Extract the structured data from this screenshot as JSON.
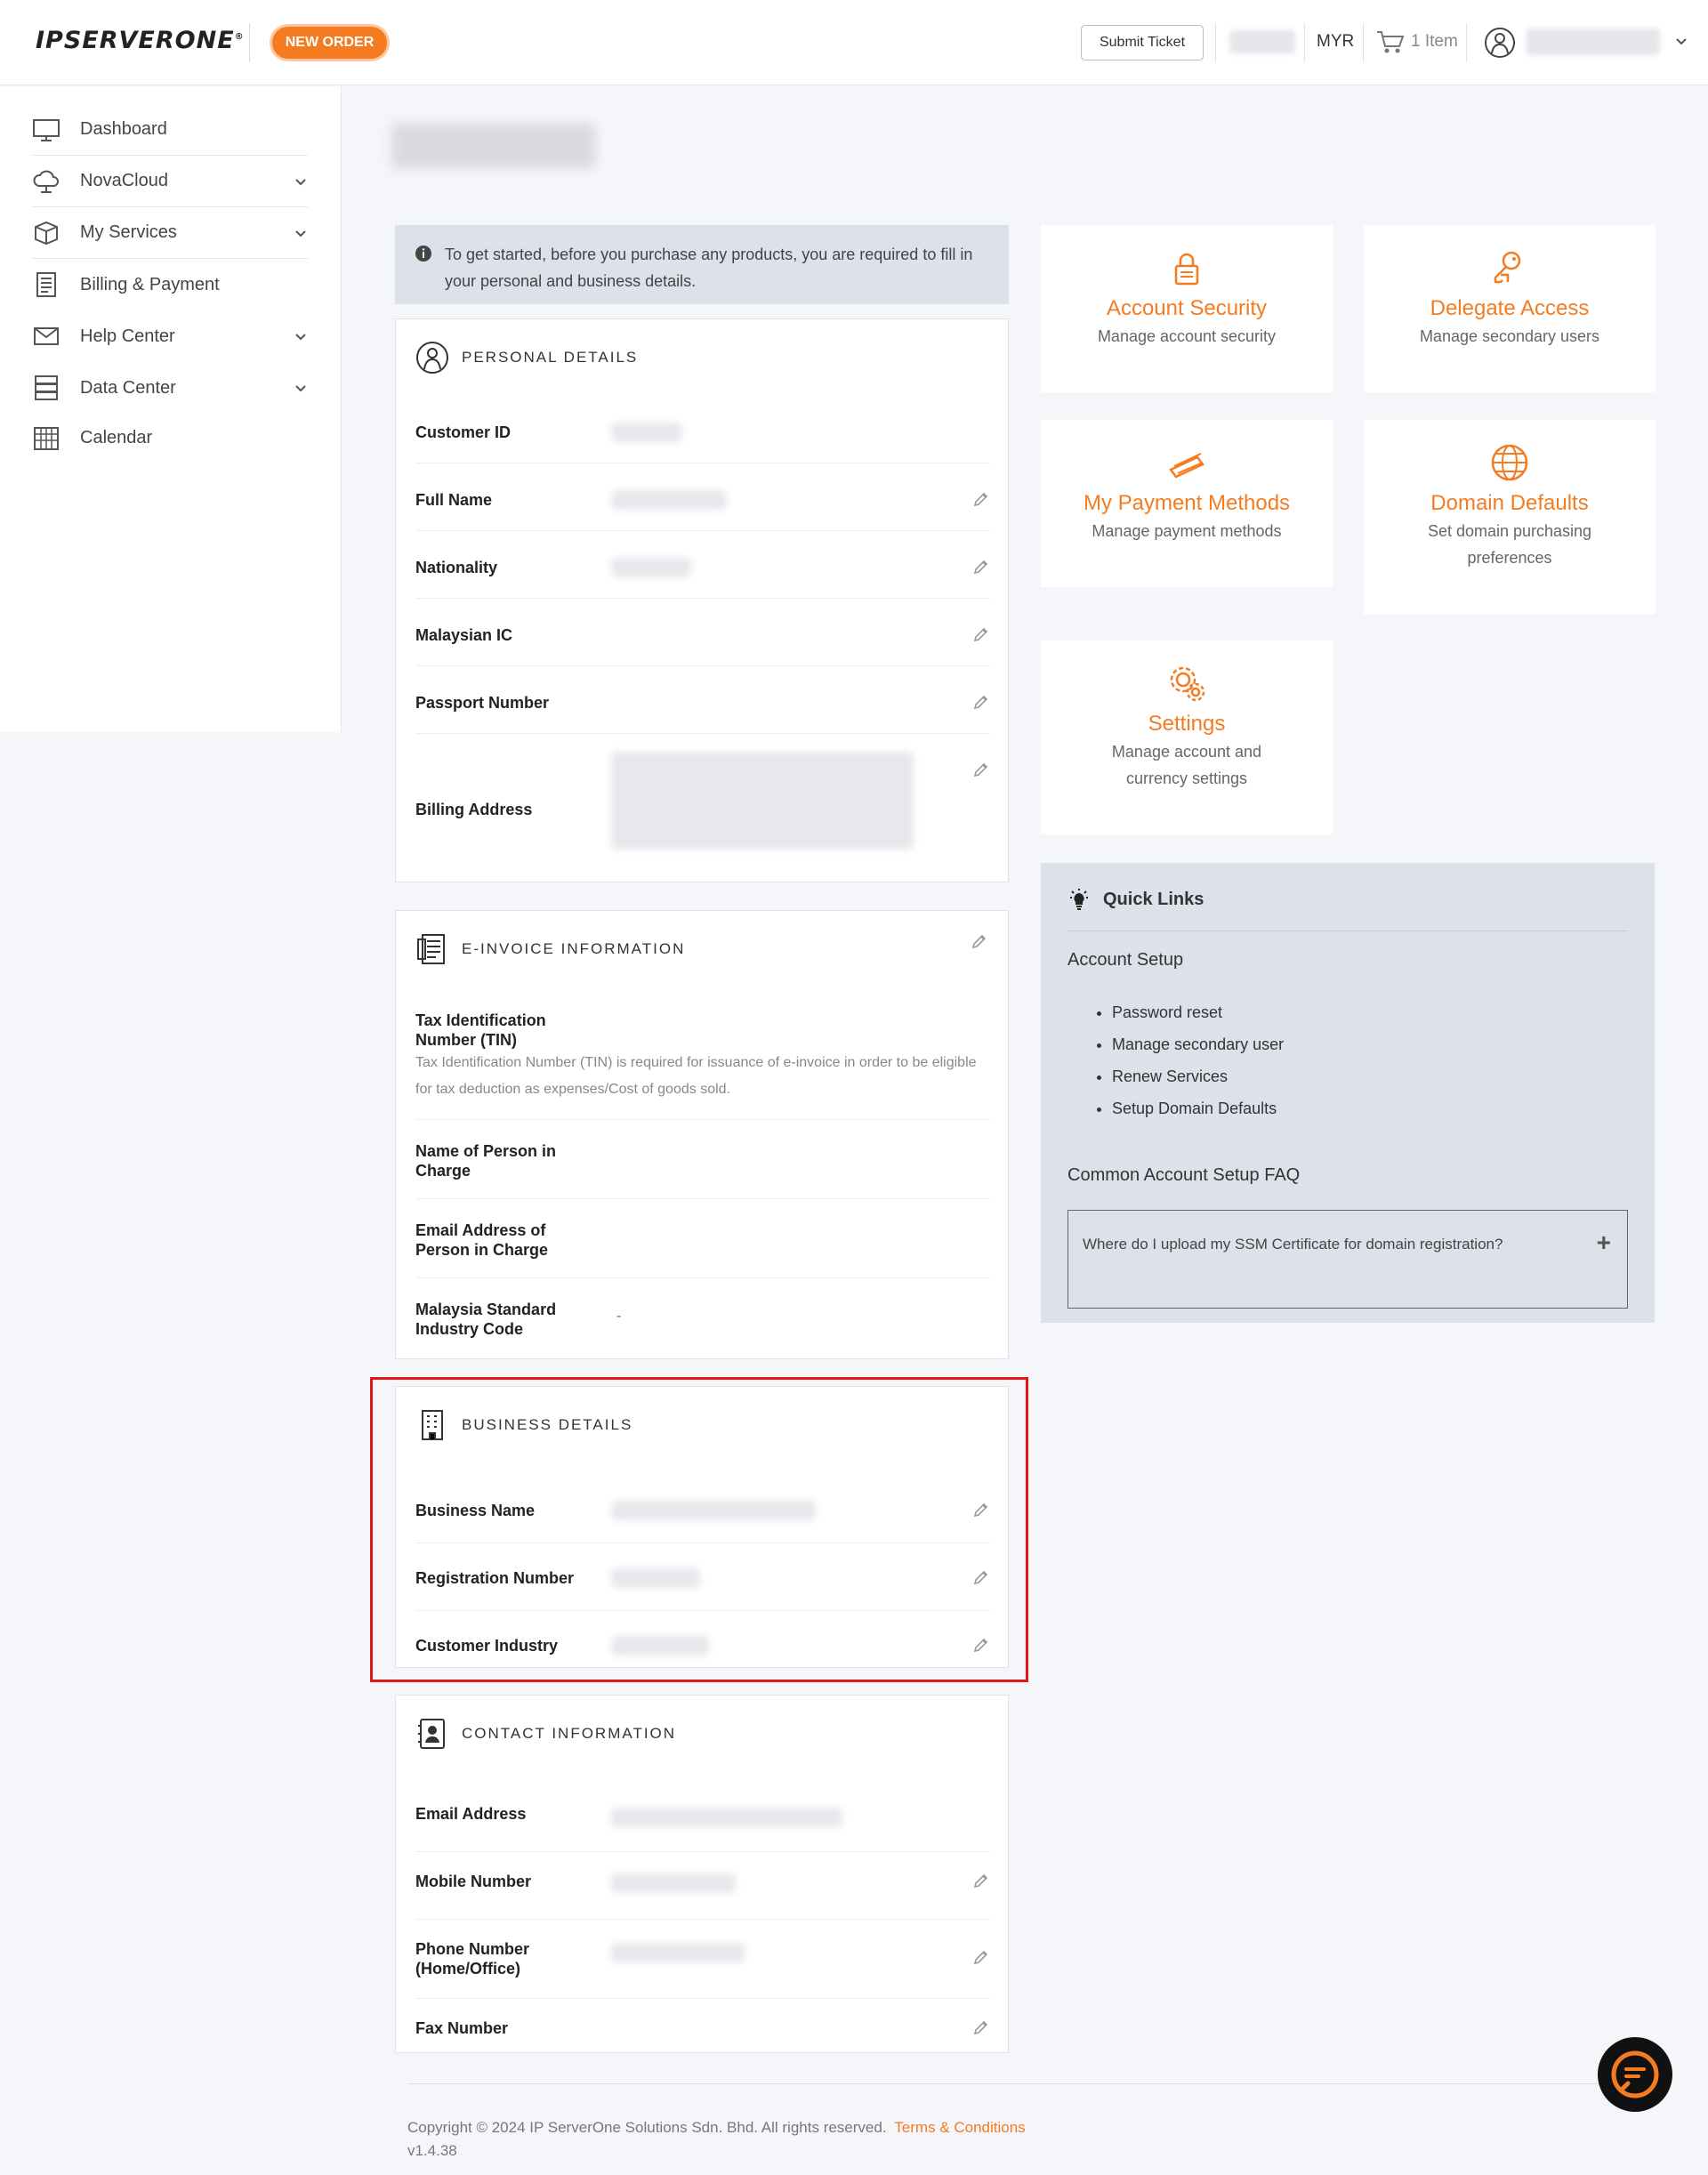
{
  "header": {
    "logo": "IPSERVERONE",
    "new_order": "NEW ORDER",
    "submit_ticket": "Submit Ticket",
    "currency": "MYR",
    "cart_label": "1 Item"
  },
  "sidebar": {
    "items": [
      {
        "label": "Dashboard",
        "icon": "monitor-icon"
      },
      {
        "label": "NovaCloud",
        "icon": "cloud-icon"
      },
      {
        "label": "My Services",
        "icon": "box-icon"
      },
      {
        "label": "Billing & Payment",
        "icon": "invoice-icon"
      },
      {
        "label": "Help Center",
        "icon": "envelope-icon"
      },
      {
        "label": "Data Center",
        "icon": "server-icon"
      },
      {
        "label": "Calendar",
        "icon": "calendar-icon"
      }
    ]
  },
  "info_banner": "To get started, before you purchase any products, you are required to fill in your personal and business details.",
  "personal": {
    "title": "PERSONAL DETAILS",
    "rows": [
      "Customer ID",
      "Full Name",
      "Nationality",
      "Malaysian IC",
      "Passport Number",
      "Billing Address"
    ]
  },
  "einvoice": {
    "title": "E-INVOICE INFORMATION",
    "tin_label": "Tax Identification Number (TIN)",
    "tin_help": "Tax Identification Number (TIN) is required for issuance of e-invoice in order to be eligible for tax deduction as expenses/Cost of goods sold.",
    "pic_name_label": "Name of Person in Charge",
    "pic_email_label": "Email Address of Person in Charge",
    "msic_label": "Malaysia Standard Industry Code",
    "msic_value": "-"
  },
  "business": {
    "title": "BUSINESS DETAILS",
    "rows": [
      "Business Name",
      "Registration Number",
      "Customer Industry"
    ]
  },
  "contact": {
    "title": "CONTACT INFORMATION",
    "rows": [
      "Email Address",
      "Mobile Number",
      "Phone Number (Home/Office)",
      "Fax Number"
    ]
  },
  "tiles": [
    {
      "title": "Account Security",
      "desc": "Manage account security",
      "icon": "lock-icon"
    },
    {
      "title": "Delegate Access",
      "desc": "Manage secondary users",
      "icon": "key-icon"
    },
    {
      "title": "My Payment Methods",
      "desc": "Manage payment methods",
      "icon": "card-icon"
    },
    {
      "title": "Domain Defaults",
      "desc": "Set domain purchasing preferences",
      "icon": "globe-icon"
    },
    {
      "title": "Settings",
      "desc": "Manage account and currency settings",
      "icon": "gears-icon"
    }
  ],
  "quick_links": {
    "title": "Quick Links",
    "account_setup": "Account Setup",
    "links": [
      "Password reset",
      "Manage secondary user",
      "Renew Services",
      "Setup Domain Defaults"
    ],
    "faq_title": "Common Account Setup FAQ",
    "faq_question": "Where do I upload my SSM Certificate for domain registration?"
  },
  "footer": {
    "copyright": "Copyright © 2024 IP ServerOne Solutions Sdn. Bhd. All rights reserved.",
    "terms": "Terms & Conditions",
    "version": "v1.4.38"
  },
  "colors": {
    "accent": "#f47b20",
    "highlight": "#e01818",
    "panel": "#dde1ea"
  }
}
